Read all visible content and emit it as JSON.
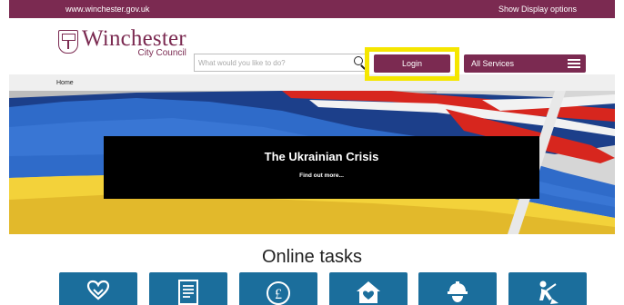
{
  "topbar": {
    "url_text": "www.winchester.gov.uk",
    "display_options": "Show Display options"
  },
  "header": {
    "logo_main": "Winchester",
    "logo_sub": "City Council",
    "search_placeholder": "What would you like to do?",
    "login_label": "Login",
    "services_label": "All Services"
  },
  "breadcrumb": {
    "home": "Home"
  },
  "hero": {
    "title": "The Ukrainian Crisis",
    "link": "Find out more..."
  },
  "tasks": {
    "title": "Online tasks",
    "tiles": [
      {
        "icon": "heart-hands-icon"
      },
      {
        "icon": "document-icon"
      },
      {
        "icon": "pound-coin-icon"
      },
      {
        "icon": "house-heart-icon"
      },
      {
        "icon": "worker-helmet-icon"
      },
      {
        "icon": "person-digging-icon"
      }
    ]
  },
  "colors": {
    "brand": "#7b2a51",
    "tile": "#1b6e9c",
    "highlight": "#f5e600",
    "breadcrumb_bg": "#efefef"
  }
}
